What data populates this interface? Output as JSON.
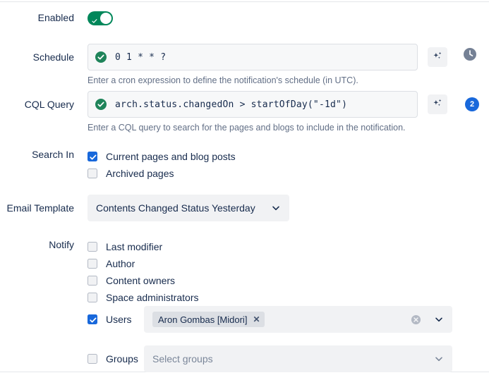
{
  "form": {
    "enabled": {
      "label": "Enabled",
      "toggle_state": "on",
      "toggle_icon": "check-icon"
    },
    "schedule": {
      "label": "Schedule",
      "value": "0 1 * * ?",
      "status_icon": "valid-check-circle-icon",
      "help": "Enter a cron expression to define the notification's schedule (in UTC).",
      "ai_icon": "sparkle-ai-icon",
      "trailing_icon": "clock-icon"
    },
    "cql_query": {
      "label": "CQL Query",
      "value": "arch.status.changedOn > startOfDay(\"-1d\")",
      "status_icon": "valid-check-circle-icon",
      "help": "Enter a CQL query to search for the pages and blogs to include in the notification.",
      "ai_icon": "sparkle-ai-icon",
      "result_count": "2"
    },
    "search_in": {
      "label": "Search In",
      "options": [
        {
          "label": "Current pages and blog posts",
          "checked": true
        },
        {
          "label": "Archived pages",
          "checked": false
        }
      ]
    },
    "email_template": {
      "label": "Email Template",
      "value": "Contents Changed Status Yesterday",
      "chevron_icon": "chevron-down-icon"
    },
    "notify": {
      "label": "Notify",
      "options": [
        {
          "label": "Last modifier",
          "checked": false
        },
        {
          "label": "Author",
          "checked": false
        },
        {
          "label": "Content owners",
          "checked": false
        },
        {
          "label": "Space administrators",
          "checked": false
        }
      ],
      "users": {
        "label": "Users",
        "checked": true,
        "chips": [
          "Aron Gombas [Midori]"
        ],
        "chip_remove_icon": "close-x-icon",
        "clear_icon": "clear-circle-icon",
        "chevron_icon": "chevron-down-icon"
      },
      "groups": {
        "label": "Groups",
        "checked": false,
        "placeholder": "Select groups",
        "chevron_icon": "chevron-down-icon"
      }
    }
  },
  "colors": {
    "toggle_on": "#00875A",
    "checkbox_on": "#1868DB",
    "badge": "#1868DB",
    "valid": "#1F845A",
    "text": "#172B4D",
    "muted": "#626F86"
  }
}
